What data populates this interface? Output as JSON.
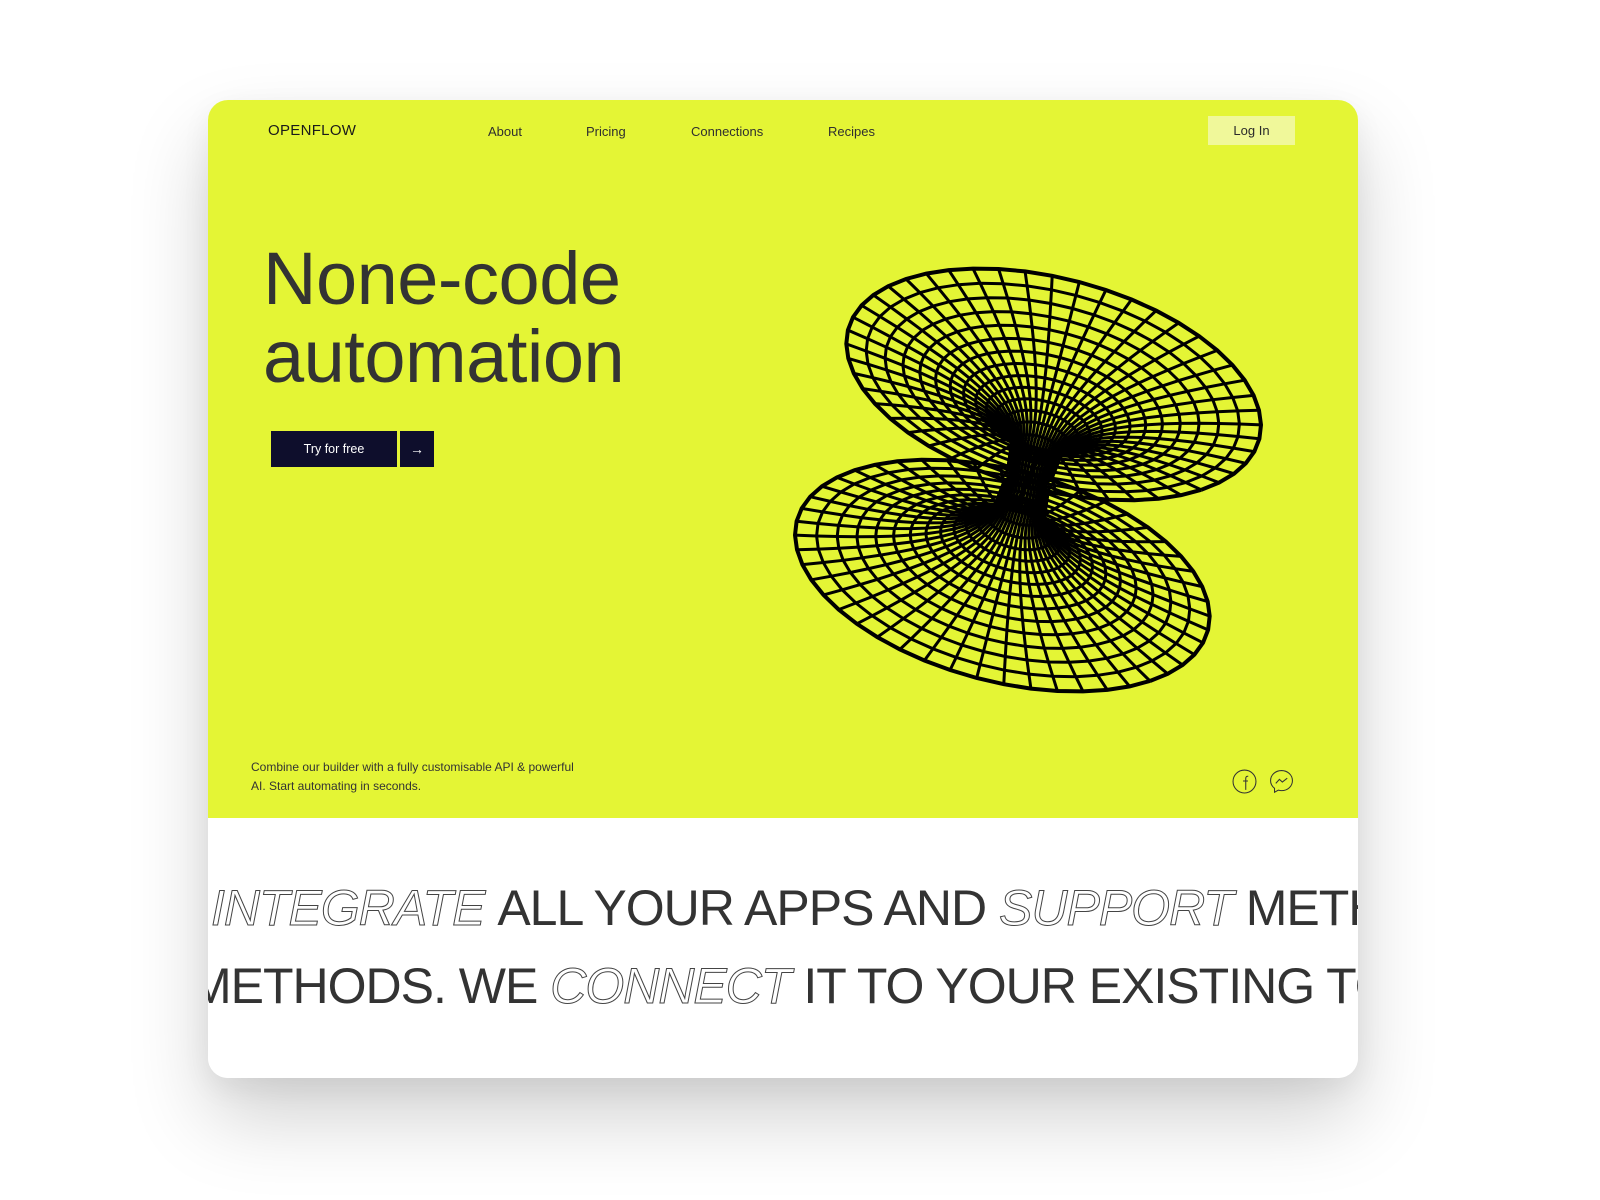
{
  "brand": {
    "name": "OPENFLOW",
    "accent_color": "#e4f535",
    "button_color": "#0e0e2c"
  },
  "nav": {
    "items": [
      {
        "label": "About"
      },
      {
        "label": "Pricing"
      },
      {
        "label": "Connections"
      },
      {
        "label": "Recipes"
      }
    ],
    "login_label": "Log In"
  },
  "hero": {
    "headline_line1": "None-code",
    "headline_line2": "automation",
    "cta_label": "Try for free",
    "cta_arrow": "→",
    "description": "Combine our builder with a fully customisable API & powerful AI. Start automating in seconds.",
    "graphic": "wireframe-hyperboloid"
  },
  "social": [
    {
      "name": "facebook-icon"
    },
    {
      "name": "messenger-icon"
    }
  ],
  "marquee": {
    "line1": [
      {
        "text": "INTEGRATE ",
        "style": "thin"
      },
      {
        "text": "ALL YOUR APPS AND ",
        "style": "bold"
      },
      {
        "text": "SUPPORT ",
        "style": "thin"
      },
      {
        "text": "METHODS.",
        "style": "bold"
      }
    ],
    "line2": [
      {
        "text": "METHODS. WE ",
        "style": "bold"
      },
      {
        "text": "CONNECT ",
        "style": "thin"
      },
      {
        "text": "IT TO YOUR EXISTING TOOLS",
        "style": "bold"
      }
    ]
  }
}
